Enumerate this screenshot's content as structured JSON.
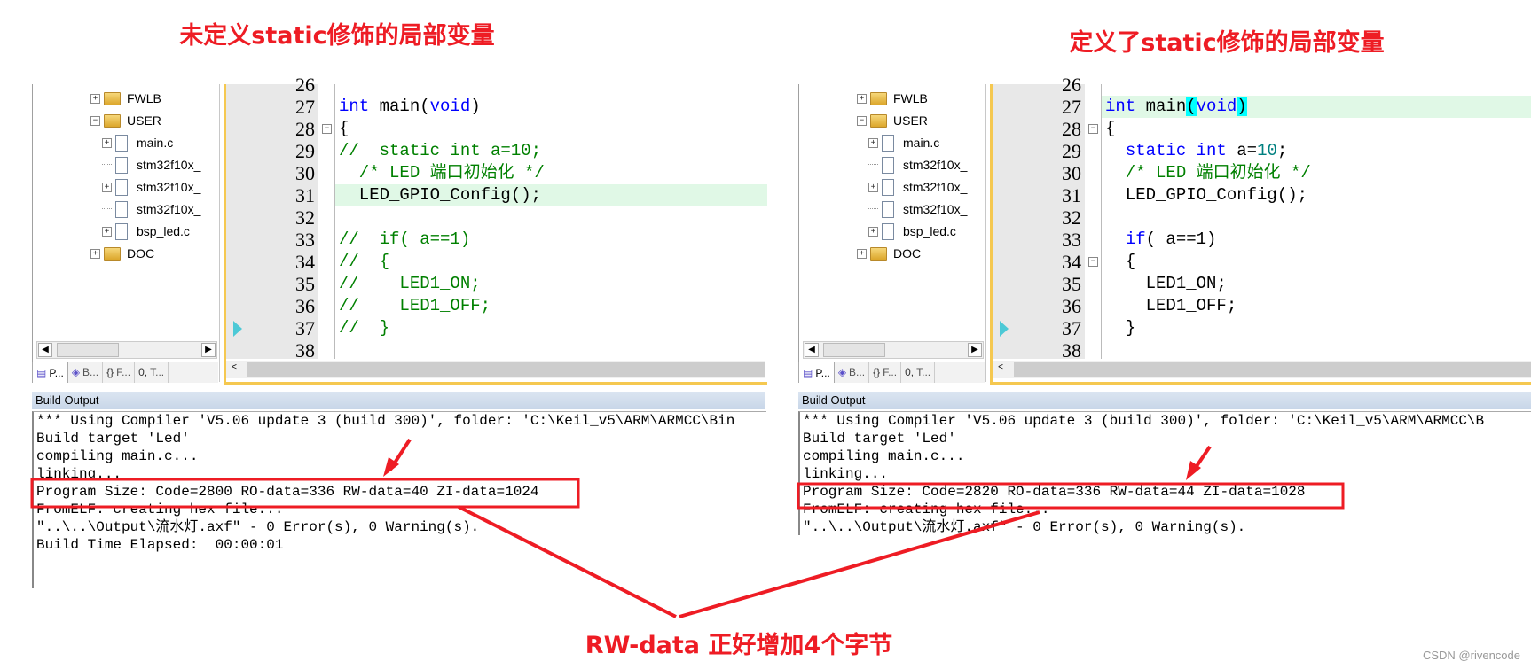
{
  "annotations": {
    "left_title": "未定义static修饰的局部变量",
    "right_title": "定义了static修饰的局部变量",
    "bottom_note": "RW-data 正好增加4个字节",
    "watermark": "CSDN @rivencode",
    "accent_color": "#ee1c24"
  },
  "panels": [
    {
      "tree": [
        {
          "label": "FWLB",
          "type": "folder",
          "level": 0,
          "expander": "+"
        },
        {
          "label": "USER",
          "type": "folder-open",
          "level": 0,
          "expander": "-"
        },
        {
          "label": "main.c",
          "type": "file",
          "level": 1,
          "expander": "+"
        },
        {
          "label": "stm32f10x_",
          "type": "file",
          "level": 1,
          "expander": ""
        },
        {
          "label": "stm32f10x_",
          "type": "file",
          "level": 1,
          "expander": "+"
        },
        {
          "label": "stm32f10x_",
          "type": "file",
          "level": 1,
          "expander": ""
        },
        {
          "label": "bsp_led.c",
          "type": "file",
          "level": 1,
          "expander": "+"
        },
        {
          "label": "DOC",
          "type": "folder",
          "level": 0,
          "expander": "+"
        }
      ],
      "tabs": [
        {
          "label": "P...",
          "icon": "project-icon"
        },
        {
          "label": "B...",
          "icon": "books-icon"
        },
        {
          "label": "F...",
          "icon": "functions-icon"
        },
        {
          "label": "T...",
          "icon": "templates-icon"
        }
      ],
      "code": [
        {
          "n": "26",
          "tokens": []
        },
        {
          "n": "27",
          "tokens": [
            {
              "t": "int",
              "k": "kw"
            },
            {
              "t": " main(",
              "k": ""
            },
            {
              "t": "void",
              "k": "kw"
            },
            {
              "t": ")",
              "k": ""
            }
          ]
        },
        {
          "n": "28",
          "fold": "-",
          "tokens": [
            {
              "t": "{",
              "k": ""
            }
          ]
        },
        {
          "n": "29",
          "tokens": [
            {
              "t": "//  static int a=10;",
              "k": "cm"
            }
          ]
        },
        {
          "n": "30",
          "tokens": [
            {
              "t": "  /* LED 端口初始化 */",
              "k": "cm"
            }
          ]
        },
        {
          "n": "31",
          "hl": true,
          "tokens": [
            {
              "t": "  LED_GPIO_Config();",
              "k": ""
            }
          ]
        },
        {
          "n": "32",
          "tokens": []
        },
        {
          "n": "33",
          "tokens": [
            {
              "t": "//  if( a==1)",
              "k": "cm"
            }
          ]
        },
        {
          "n": "34",
          "tokens": [
            {
              "t": "//  {",
              "k": "cm"
            }
          ]
        },
        {
          "n": "35",
          "tokens": [
            {
              "t": "//    LED1_ON;",
              "k": "cm"
            }
          ]
        },
        {
          "n": "36",
          "tokens": [
            {
              "t": "//    LED1_OFF;",
              "k": "cm"
            }
          ]
        },
        {
          "n": "37",
          "marker": true,
          "tokens": [
            {
              "t": "//  }",
              "k": "cm"
            }
          ]
        },
        {
          "n": "38",
          "tokens": []
        }
      ],
      "build_output_title": "Build Output",
      "build_output": [
        "*** Using Compiler 'V5.06 update 3 (build 300)', folder: 'C:\\Keil_v5\\ARM\\ARMCC\\Bin",
        "Build target 'Led'",
        "compiling main.c...",
        "linking...",
        "Program Size: Code=2800 RO-data=336 RW-data=40 ZI-data=1024",
        "FromELF: creating hex file...",
        "\"..\\..\\Output\\流水灯.axf\" - 0 Error(s), 0 Warning(s).",
        "Build Time Elapsed:  00:00:01"
      ]
    },
    {
      "tree": [
        {
          "label": "FWLB",
          "type": "folder",
          "level": 0,
          "expander": "+"
        },
        {
          "label": "USER",
          "type": "folder-open",
          "level": 0,
          "expander": "-"
        },
        {
          "label": "main.c",
          "type": "file",
          "level": 1,
          "expander": "+"
        },
        {
          "label": "stm32f10x_",
          "type": "file",
          "level": 1,
          "expander": ""
        },
        {
          "label": "stm32f10x_",
          "type": "file",
          "level": 1,
          "expander": "+"
        },
        {
          "label": "stm32f10x_",
          "type": "file",
          "level": 1,
          "expander": ""
        },
        {
          "label": "bsp_led.c",
          "type": "file",
          "level": 1,
          "expander": "+"
        },
        {
          "label": "DOC",
          "type": "folder",
          "level": 0,
          "expander": "+"
        }
      ],
      "tabs": [
        {
          "label": "P...",
          "icon": "project-icon"
        },
        {
          "label": "B...",
          "icon": "books-icon"
        },
        {
          "label": "F...",
          "icon": "functions-icon"
        },
        {
          "label": "T...",
          "icon": "templates-icon"
        }
      ],
      "code": [
        {
          "n": "26",
          "tokens": []
        },
        {
          "n": "27",
          "hl": true,
          "tokens": [
            {
              "t": "int",
              "k": "kw"
            },
            {
              "t": " main",
              "k": ""
            },
            {
              "t": "(",
              "k": "br"
            },
            {
              "t": "void",
              "k": "kw"
            },
            {
              "t": ")",
              "k": "br"
            }
          ]
        },
        {
          "n": "28",
          "fold": "-",
          "tokens": [
            {
              "t": "{",
              "k": ""
            }
          ]
        },
        {
          "n": "29",
          "tokens": [
            {
              "t": "  ",
              "k": ""
            },
            {
              "t": "static int",
              "k": "kw"
            },
            {
              "t": " a=",
              "k": ""
            },
            {
              "t": "10",
              "k": "num"
            },
            {
              "t": ";",
              "k": ""
            }
          ]
        },
        {
          "n": "30",
          "tokens": [
            {
              "t": "  /* LED 端口初始化 */",
              "k": "cm"
            }
          ]
        },
        {
          "n": "31",
          "tokens": [
            {
              "t": "  LED_GPIO_Config();",
              "k": ""
            }
          ]
        },
        {
          "n": "32",
          "tokens": []
        },
        {
          "n": "33",
          "tokens": [
            {
              "t": "  ",
              "k": ""
            },
            {
              "t": "if",
              "k": "kw"
            },
            {
              "t": "( a==1)",
              "k": ""
            }
          ]
        },
        {
          "n": "34",
          "fold": "-",
          "tokens": [
            {
              "t": "  {",
              "k": ""
            }
          ]
        },
        {
          "n": "35",
          "tokens": [
            {
              "t": "    LED1_ON;",
              "k": ""
            }
          ]
        },
        {
          "n": "36",
          "tokens": [
            {
              "t": "    LED1_OFF;",
              "k": ""
            }
          ]
        },
        {
          "n": "37",
          "marker": true,
          "tokens": [
            {
              "t": "  }",
              "k": ""
            }
          ]
        },
        {
          "n": "38",
          "tokens": []
        }
      ],
      "build_output_title": "Build Output",
      "build_output": [
        "*** Using Compiler 'V5.06 update 3 (build 300)', folder: 'C:\\Keil_v5\\ARM\\ARMCC\\B",
        "Build target 'Led'",
        "compiling main.c...",
        "linking...",
        "Program Size: Code=2820 RO-data=336 RW-data=44 ZI-data=1028",
        "FromELF: creating hex file...",
        "\"..\\..\\Output\\流水灯.axf\" - 0 Error(s), 0 Warning(s)."
      ]
    }
  ]
}
